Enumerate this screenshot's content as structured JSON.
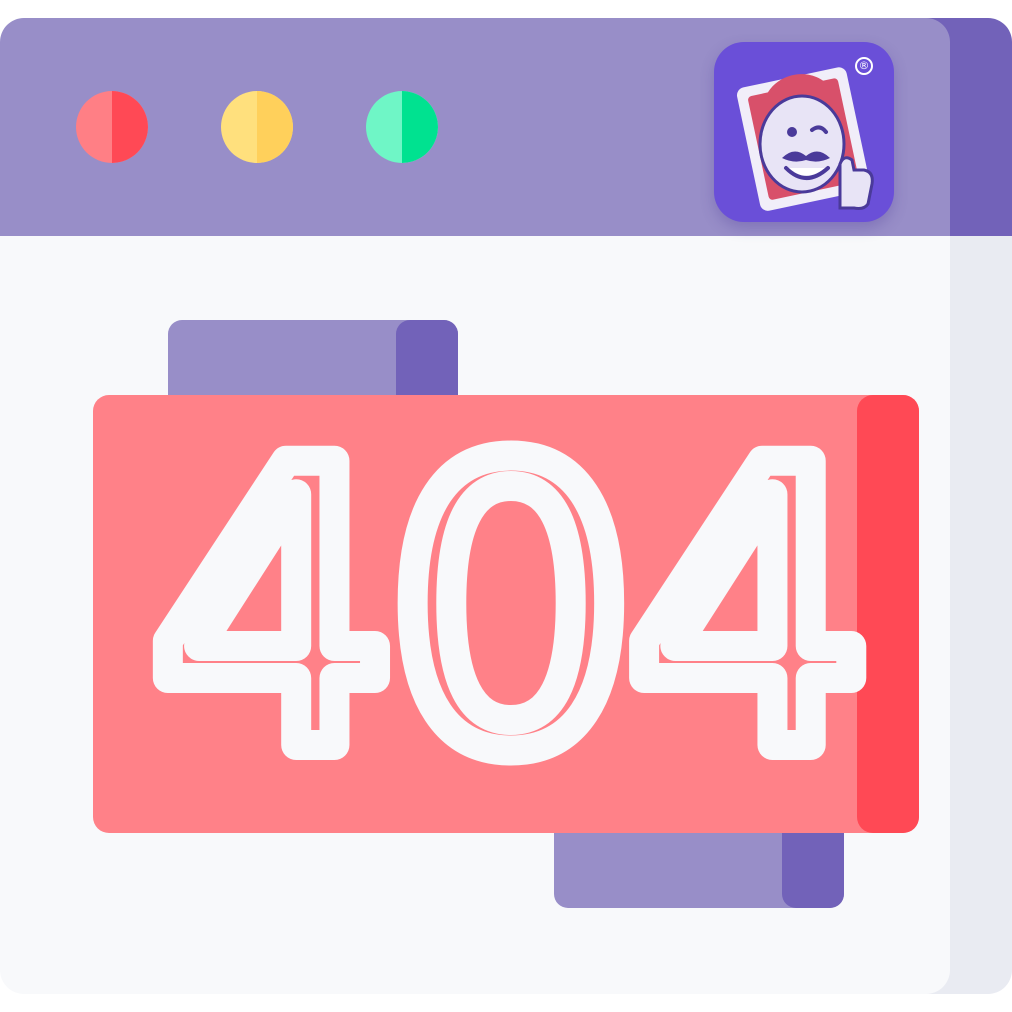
{
  "window": {
    "colors": {
      "titlebar": "#988ec8",
      "titlebar_shade": "#7262b9",
      "body": "#f8f9fb",
      "body_shade": "#e9ebf2"
    },
    "controls": [
      {
        "name": "close",
        "color": "#ff7f85"
      },
      {
        "name": "minimize",
        "color": "#ffe07d"
      },
      {
        "name": "maximize",
        "color": "#6ff6c6"
      }
    ]
  },
  "logo": {
    "icon": "mascot-thumbs-up-icon",
    "registered_mark": "®",
    "color": "#6a4fd8"
  },
  "error": {
    "code": "404",
    "panel_color": "#ff8188",
    "panel_shade": "#ff4955",
    "text_color": "#f8f9fb"
  }
}
